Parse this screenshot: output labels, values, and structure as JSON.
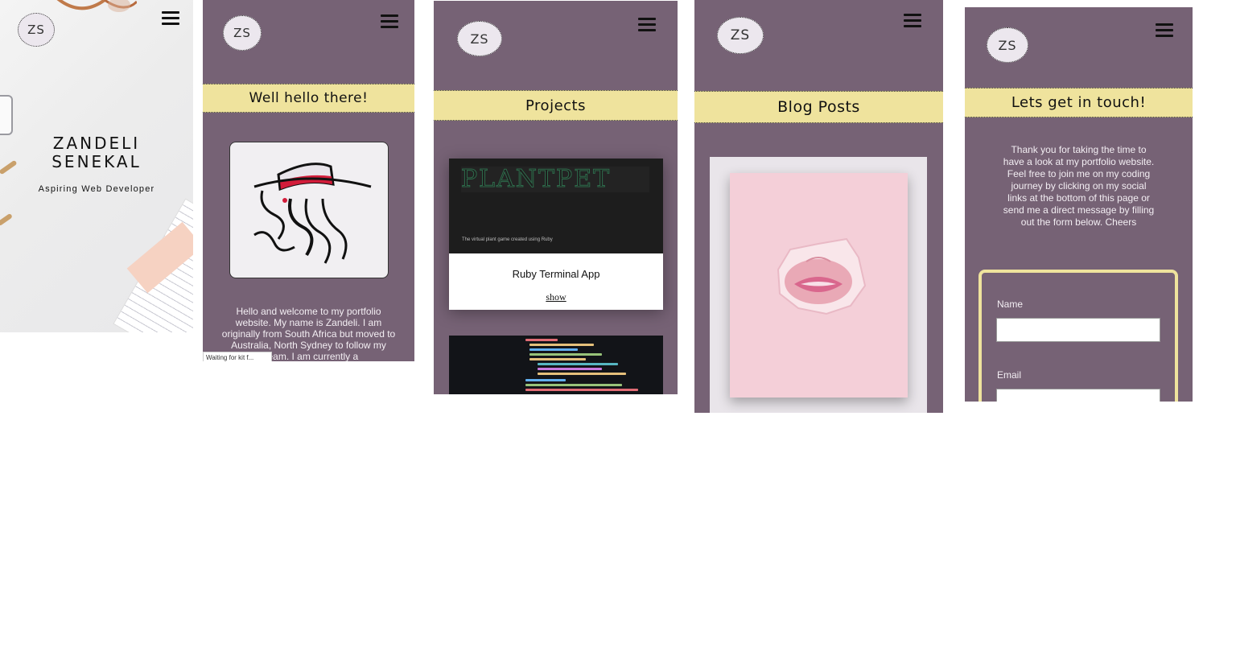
{
  "colors": {
    "purple": "#766275",
    "banner_yellow": "#efe39d",
    "logo_bg": "#ece7ee"
  },
  "screens": {
    "home": {
      "logo": "ZS",
      "name_line1": "ZANDELI",
      "name_line2": "SENEKAL",
      "subtitle": "Aspiring Web Developer",
      "menu_icon": "hamburger-icon"
    },
    "about": {
      "logo": "ZS",
      "banner": "Well hello there!",
      "intro_text": "Hello and welcome to my portfolio website. My name is Zandeli. I am originally from South Africa but moved to Australia, North Sydney to follow my dream. I am currently a",
      "status": "Waiting for kit f..."
    },
    "projects": {
      "logo": "ZS",
      "banner": "Projects",
      "cards": [
        {
          "image_title": "PLANTPET",
          "image_caption": "The virtual plant game created using Ruby",
          "title": "Ruby Terminal App",
          "link": "show"
        }
      ]
    },
    "blog": {
      "logo": "ZS",
      "banner": "Blog Posts"
    },
    "contact": {
      "logo": "ZS",
      "banner": "Lets get in touch!",
      "text": "Thank you for taking the time to have a look at my portfolio website. Feel free to join me on my coding journey by clicking on my social links at the bottom of this page or send me a direct message by filling out the form below. Cheers",
      "form": {
        "name_label": "Name",
        "email_label": "Email"
      }
    }
  }
}
